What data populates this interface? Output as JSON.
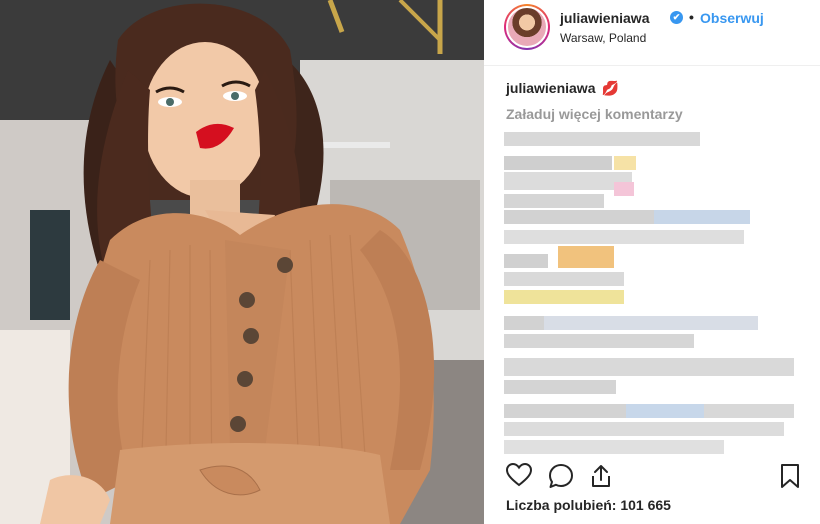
{
  "post": {
    "username": "juliawieniawa",
    "verified_mark": "✔",
    "separator": "•",
    "follow_label": "Obserwuj",
    "location": "Warsaw, Poland"
  },
  "caption": {
    "username": "juliawieniawa",
    "emoji": "💋"
  },
  "comments": {
    "load_more": "Załaduj więcej komentarzy"
  },
  "likes": {
    "text": "Liczba polubień: 101 665"
  },
  "icons": {
    "like": "heart-icon",
    "comment": "comment-icon",
    "share": "share-icon",
    "save": "bookmark-icon",
    "verified": "verified-badge-icon"
  },
  "colors": {
    "accent": "#3897f0",
    "text": "#262626",
    "muted": "#999999",
    "sweater": "#c98a5e",
    "lips": "#d0021b"
  }
}
